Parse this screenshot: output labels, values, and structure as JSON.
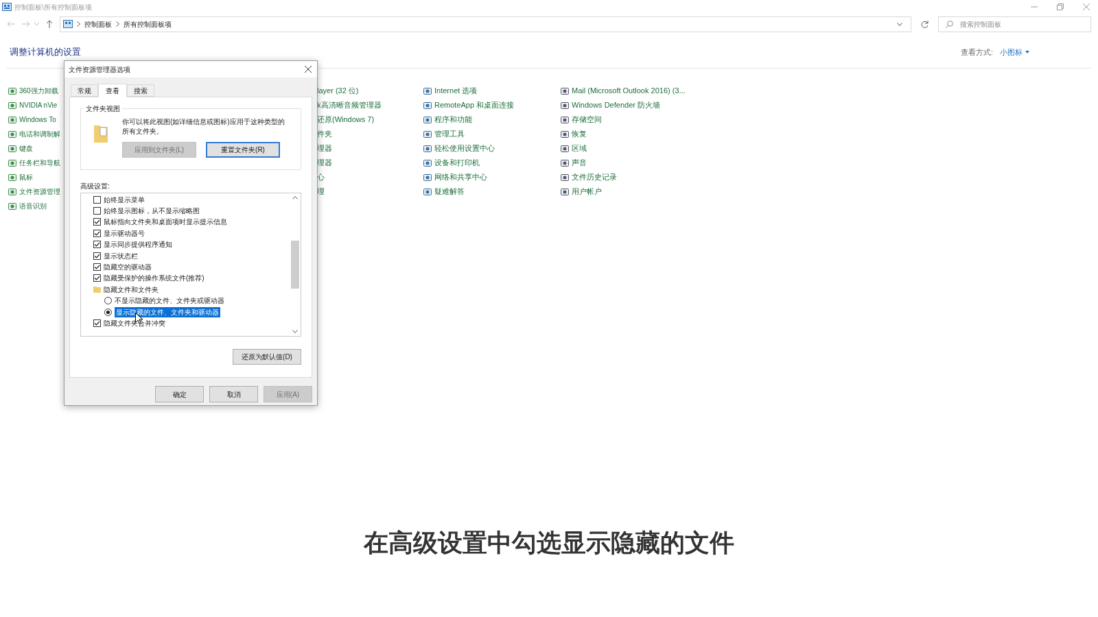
{
  "window": {
    "title": "控制面板\\所有控制面板项"
  },
  "address": {
    "crumbs": [
      "控制面板",
      "所有控制面板项"
    ]
  },
  "search": {
    "placeholder": "搜索控制面板"
  },
  "heading": "调整计算机的设置",
  "view_by": {
    "label": "查看方式:",
    "value": "小图标"
  },
  "columns": [
    [
      {
        "label": "360强力卸载"
      },
      {
        "label": "NVIDIA nVie"
      },
      {
        "label": "Windows To"
      },
      {
        "label": "电话和调制解"
      },
      {
        "label": "键盘"
      },
      {
        "label": "任务栏和导航"
      },
      {
        "label": "鼠标"
      },
      {
        "label": "文件资源管理"
      },
      {
        "label": "语音识别"
      }
    ],
    [
      {
        "label": "layer (32 位)"
      },
      {
        "label": "k高清晰音频管理器"
      },
      {
        "label": "还原(Windows 7)"
      },
      {
        "label": "件夹"
      },
      {
        "label": "理器"
      },
      {
        "label": "理器"
      },
      {
        "label": "心"
      },
      {
        "label": "理"
      }
    ],
    [
      {
        "label": "Internet 选项"
      },
      {
        "label": "RemoteApp 和桌面连接"
      },
      {
        "label": "程序和功能"
      },
      {
        "label": "管理工具"
      },
      {
        "label": "轻松使用设置中心"
      },
      {
        "label": "设备和打印机"
      },
      {
        "label": "网络和共享中心"
      },
      {
        "label": "疑难解答"
      }
    ],
    [
      {
        "label": "Mail (Microsoft Outlook 2016) (3..."
      },
      {
        "label": "Windows Defender 防火墙"
      },
      {
        "label": "存储空间"
      },
      {
        "label": "恢复"
      },
      {
        "label": "区域"
      },
      {
        "label": "声音"
      },
      {
        "label": "文件历史记录"
      },
      {
        "label": "用户帐户"
      }
    ]
  ],
  "dialog": {
    "title": "文件资源管理器选项",
    "tabs": [
      {
        "label": "常规",
        "selected": false
      },
      {
        "label": "查看",
        "selected": true
      },
      {
        "label": "搜索",
        "selected": false
      }
    ],
    "folder_views": {
      "title": "文件夹视图",
      "description": "你可以将此视图(如详细信息或图标)应用于这种类型的所有文件夹。",
      "buttons": [
        {
          "label": "应用到文件夹(L)",
          "disabled": true
        },
        {
          "label": "重置文件夹(R)",
          "disabled": false
        }
      ]
    },
    "advanced": {
      "label": "高级设置:",
      "items": [
        {
          "kind": "checkbox",
          "label": "始终显示菜单",
          "checked": false
        },
        {
          "kind": "checkbox",
          "label": "始终显示图标，从不显示缩略图",
          "checked": false
        },
        {
          "kind": "checkbox",
          "label": "鼠标指向文件夹和桌面项时显示提示信息",
          "checked": true
        },
        {
          "kind": "checkbox",
          "label": "显示驱动器号",
          "checked": true
        },
        {
          "kind": "checkbox",
          "label": "显示同步提供程序通知",
          "checked": true
        },
        {
          "kind": "checkbox",
          "label": "显示状态栏",
          "checked": true
        },
        {
          "kind": "checkbox",
          "label": "隐藏空的驱动器",
          "checked": true
        },
        {
          "kind": "checkbox",
          "label": "隐藏受保护的操作系统文件(推荐)",
          "checked": true
        },
        {
          "kind": "folder",
          "label": "隐藏文件和文件夹",
          "children": [
            {
              "kind": "radio",
              "label": "不显示隐藏的文件、文件夹或驱动器",
              "checked": false,
              "selected": false
            },
            {
              "kind": "radio",
              "label": "显示隐藏的文件、文件夹和驱动器",
              "checked": true,
              "selected": true
            }
          ]
        },
        {
          "kind": "checkbox",
          "label": "隐藏文件夹合并冲突",
          "checked": true
        }
      ]
    },
    "restore_button": "还原为默认值(D)",
    "buttons": [
      {
        "label": "确定",
        "disabled": false
      },
      {
        "label": "取消",
        "disabled": false
      },
      {
        "label": "应用(A)",
        "disabled": true
      }
    ]
  },
  "caption": "在高级设置中勾选显示隐藏的文件"
}
